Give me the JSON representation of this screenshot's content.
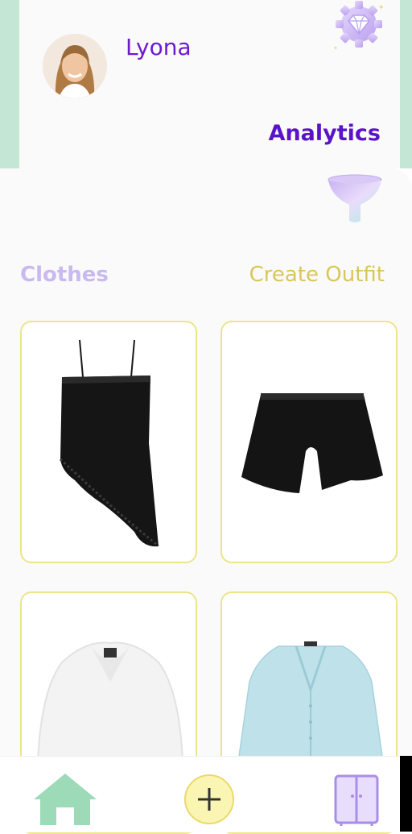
{
  "header": {
    "username": "Lyona",
    "analytics_label": "Analytics"
  },
  "tabs": {
    "clothes": "Clothes",
    "create_outfit": "Create Outfit"
  },
  "clothes": [
    {
      "item": "black-lace-slip-top-icon"
    },
    {
      "item": "black-shorts-icon"
    },
    {
      "item": "white-fur-coat-icon"
    },
    {
      "item": "light-blue-cardigan-icon"
    }
  ],
  "nav": {
    "home": "home-icon",
    "add": "plus-icon",
    "wardrobe": "wardrobe-icon"
  },
  "colors": {
    "accent_purple": "#6b1bd1",
    "mint": "#c4e6d4",
    "gold": "#d9c65a",
    "card_border": "#ede48a"
  }
}
